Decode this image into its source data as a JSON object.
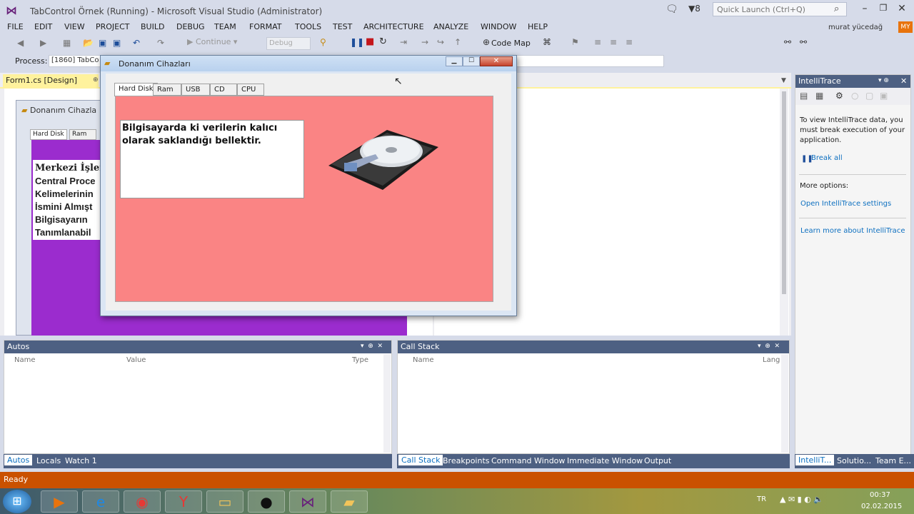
{
  "window": {
    "title": "TabControl Örnek (Running) - Microsoft Visual Studio (Administrator)",
    "quick_launch_placeholder": "Quick Launch (Ctrl+Q)",
    "notification_count": "8"
  },
  "user": {
    "name": "murat yücedağ",
    "initials": "MY"
  },
  "menu": [
    "FILE",
    "EDIT",
    "VIEW",
    "PROJECT",
    "BUILD",
    "DEBUG",
    "TEAM",
    "FORMAT",
    "TOOLS",
    "TEST",
    "ARCHITECTURE",
    "ANALYZE",
    "WINDOW",
    "HELP"
  ],
  "toolbar": {
    "continue_label": "Continue",
    "config_value": "Debug",
    "codemap_label": "Code Map"
  },
  "process": {
    "label": "Process:",
    "value": "[1860] TabCo"
  },
  "doc_tab": {
    "label": "Form1.cs [Design]"
  },
  "designer": {
    "form_title": "Donanım Cihazla",
    "tabs": [
      "Hard Disk",
      "Ram"
    ],
    "text_lines": [
      "Merkezi İşlem",
      "Central Proce",
      "Kelimelerinin",
      "İsmini Almışt",
      "Bilgisayarın",
      "Tanımlanabil"
    ]
  },
  "running_form": {
    "title": "Donanım Cihazları",
    "tabs": [
      "Hard Disk",
      "Ram",
      "USB",
      "CD",
      "CPU"
    ],
    "text": "Bilgisayarda ki verilerin kalıcı olarak saklandığı bellektir."
  },
  "intellitrace": {
    "title": "IntelliTrace",
    "description": "To view IntelliTrace data, you must break execution of your application.",
    "break_all": "Break all",
    "more_options": "More options:",
    "open_settings": "Open IntelliTrace settings",
    "learn_more": "Learn more about IntelliTrace",
    "tabs": [
      "IntelliT...",
      "Solutio...",
      "Team E..."
    ]
  },
  "autos": {
    "title": "Autos",
    "columns": [
      "Name",
      "Value",
      "Type"
    ],
    "tabs": [
      "Autos",
      "Locals",
      "Watch 1"
    ]
  },
  "callstack": {
    "title": "Call Stack",
    "columns": [
      "Name",
      "Lang"
    ],
    "tabs": [
      "Call Stack",
      "Breakpoints",
      "Command Window",
      "Immediate Window",
      "Output"
    ]
  },
  "status": {
    "text": "Ready"
  },
  "taskbar": {
    "language": "TR",
    "time": "00:37",
    "date": "02.02.2015"
  },
  "colors": {
    "accent": "#68217a",
    "status_bar": "#ca5100",
    "tool_header": "#4d6082",
    "tab_page_bg": "#fa8484",
    "designer_bg": "#9b2cce",
    "doc_tab": "#fff29d"
  }
}
